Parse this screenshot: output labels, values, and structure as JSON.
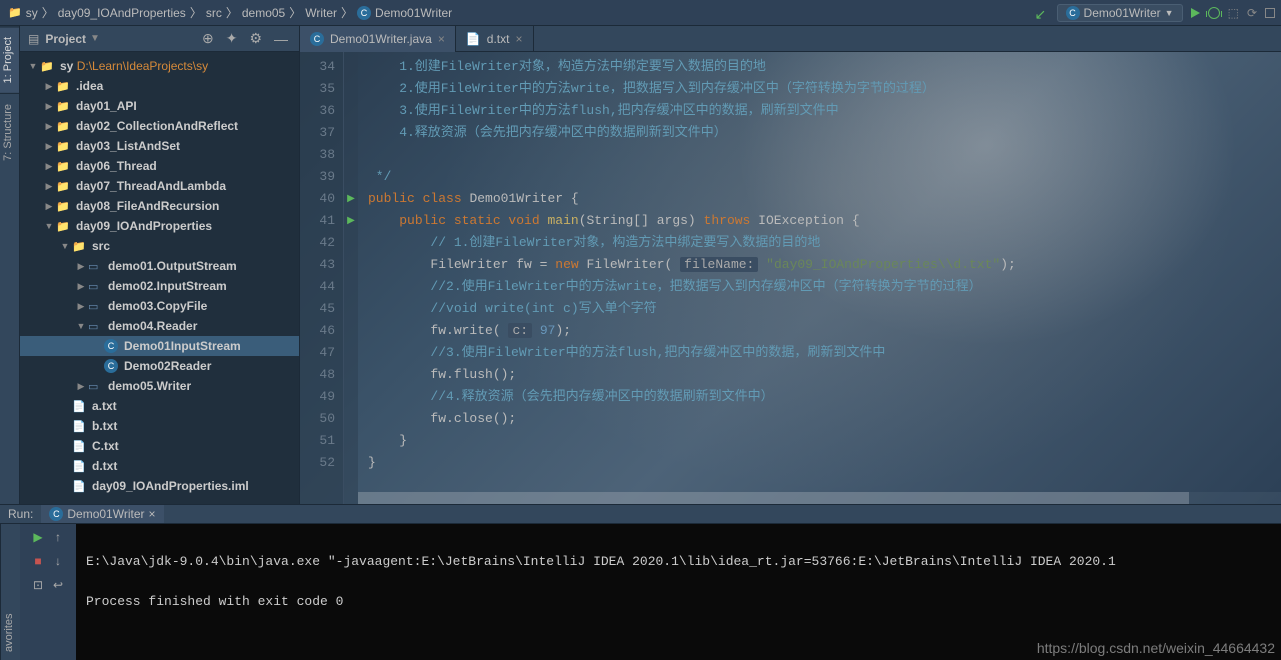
{
  "breadcrumb": [
    "sy",
    "day09_IOAndProperties",
    "src",
    "demo05",
    "Writer",
    "Demo01Writer"
  ],
  "nav": {
    "run_config": "Demo01Writer"
  },
  "side_tabs": [
    "1: Project",
    "7: Structure"
  ],
  "project_panel": {
    "title": "Project"
  },
  "tree": [
    {
      "d": 0,
      "exp": "open",
      "ic": "folder",
      "label": "sy",
      "extra": "D:\\Learn\\IdeaProjects\\sy",
      "cls": "orange"
    },
    {
      "d": 1,
      "exp": "closed",
      "ic": "folder",
      "label": ".idea"
    },
    {
      "d": 1,
      "exp": "closed",
      "ic": "folder",
      "label": "day01_API"
    },
    {
      "d": 1,
      "exp": "closed",
      "ic": "folder",
      "label": "day02_CollectionAndReflect"
    },
    {
      "d": 1,
      "exp": "closed",
      "ic": "folder",
      "label": "day03_ListAndSet"
    },
    {
      "d": 1,
      "exp": "closed",
      "ic": "folder",
      "label": "day06_Thread"
    },
    {
      "d": 1,
      "exp": "closed",
      "ic": "folder",
      "label": "day07_ThreadAndLambda"
    },
    {
      "d": 1,
      "exp": "closed",
      "ic": "folder",
      "label": "day08_FileAndRecursion"
    },
    {
      "d": 1,
      "exp": "open",
      "ic": "folder",
      "label": "day09_IOAndProperties"
    },
    {
      "d": 2,
      "exp": "open",
      "ic": "folder",
      "label": "src"
    },
    {
      "d": 3,
      "exp": "closed",
      "ic": "pkg",
      "label": "demo01.OutputStream"
    },
    {
      "d": 3,
      "exp": "closed",
      "ic": "pkg",
      "label": "demo02.InputStream"
    },
    {
      "d": 3,
      "exp": "closed",
      "ic": "pkg",
      "label": "demo03.CopyFile"
    },
    {
      "d": 3,
      "exp": "open",
      "ic": "pkg",
      "label": "demo04.Reader"
    },
    {
      "d": 4,
      "exp": "none",
      "ic": "class",
      "label": "Demo01InputStream",
      "sel": true
    },
    {
      "d": 4,
      "exp": "none",
      "ic": "class",
      "label": "Demo02Reader"
    },
    {
      "d": 3,
      "exp": "closed",
      "ic": "pkg",
      "label": "demo05.Writer"
    },
    {
      "d": 2,
      "exp": "none",
      "ic": "file",
      "label": "a.txt"
    },
    {
      "d": 2,
      "exp": "none",
      "ic": "file",
      "label": "b.txt"
    },
    {
      "d": 2,
      "exp": "none",
      "ic": "file",
      "label": "C.txt"
    },
    {
      "d": 2,
      "exp": "none",
      "ic": "file",
      "label": "d.txt"
    },
    {
      "d": 2,
      "exp": "none",
      "ic": "file",
      "label": "day09_IOAndProperties.iml"
    }
  ],
  "editor_tabs": [
    {
      "icon": "class",
      "label": "Demo01Writer.java",
      "active": true
    },
    {
      "icon": "file",
      "label": "d.txt",
      "active": false
    }
  ],
  "code": {
    "start": 34,
    "lines": [
      {
        "t": "cmt",
        "txt": "    1.创建FileWriter对象，构造方法中绑定要写入数据的目的地"
      },
      {
        "t": "cmt",
        "txt": "    2.使用FileWriter中的方法write，把数据写入到内存缓冲区中（字符转换为字节的过程）"
      },
      {
        "t": "cmt",
        "txt": "    3.使用FileWriter中的方法flush,把内存缓冲区中的数据，刷新到文件中"
      },
      {
        "t": "cmt",
        "txt": "    4.释放资源（会先把内存缓冲区中的数据刷新到文件中）"
      },
      {
        "t": "blank",
        "txt": ""
      },
      {
        "t": "cmt",
        "txt": " */"
      },
      {
        "t": "class",
        "mark": true
      },
      {
        "t": "main",
        "mark": true
      },
      {
        "t": "cmt2",
        "txt": "        // 1.创建FileWriter对象，构造方法中绑定要写入数据的目的地"
      },
      {
        "t": "fw"
      },
      {
        "t": "cmt2",
        "txt": "        //2.使用FileWriter中的方法write，把数据写入到内存缓冲区中（字符转换为字节的过程）"
      },
      {
        "t": "cmt2",
        "txt": "        //void write(int c)写入单个字符"
      },
      {
        "t": "write"
      },
      {
        "t": "cmt2",
        "txt": "        //3.使用FileWriter中的方法flush,把内存缓冲区中的数据，刷新到文件中"
      },
      {
        "t": "flush"
      },
      {
        "t": "cmt2",
        "txt": "        //4.释放资源（会先把内存缓冲区中的数据刷新到文件中）"
      },
      {
        "t": "close"
      },
      {
        "t": "plain",
        "txt": "    }"
      },
      {
        "t": "plain",
        "txt": "}"
      }
    ]
  },
  "strings": {
    "filename_hint": "fileName:",
    "filename": "\"day09_IOAndProperties\\\\d.txt\"",
    "c_hint": "c:",
    "c_val": "97"
  },
  "run": {
    "label": "Run:",
    "tab": "Demo01Writer",
    "out1": "E:\\Java\\jdk-9.0.4\\bin\\java.exe \"-javaagent:E:\\JetBrains\\IntelliJ IDEA 2020.1\\lib\\idea_rt.jar=53766:E:\\JetBrains\\IntelliJ IDEA 2020.1",
    "out2": "",
    "out3": "Process finished with exit code 0"
  },
  "watermark": "https://blog.csdn.net/weixin_44664432",
  "favorites_tab": "avorites"
}
